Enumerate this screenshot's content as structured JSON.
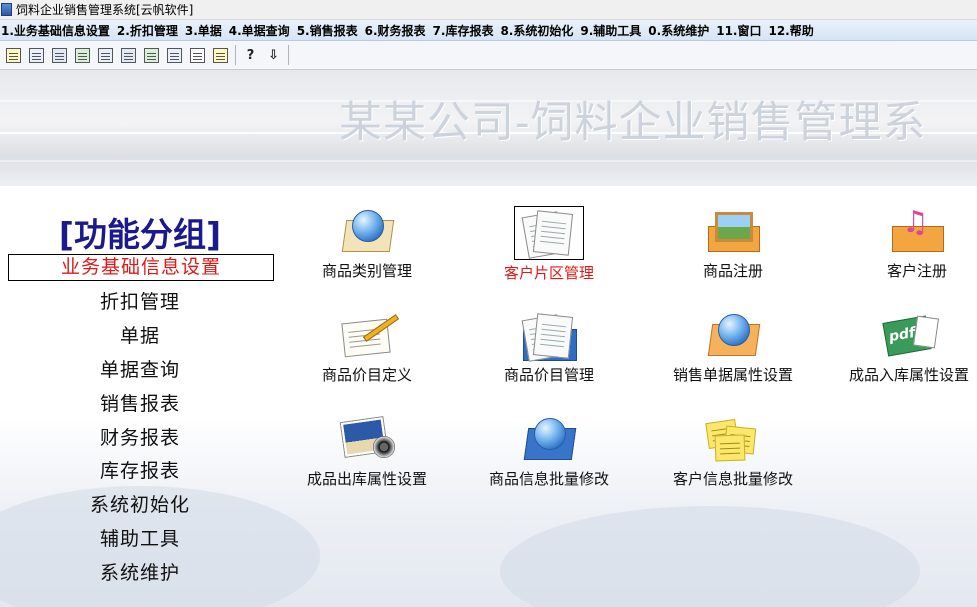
{
  "window": {
    "title": "饲料企业销售管理系统[云帆软件]"
  },
  "menu": [
    "1.业务基础信息设置",
    "2.折扣管理",
    "3.单据",
    "4.单据查询",
    "5.销售报表",
    "6.财务报表",
    "7.库存报表",
    "8.系统初始化",
    "9.辅助工具",
    "0.系统维护",
    "11.窗口",
    "12.帮助"
  ],
  "toolbar": {
    "icons": [
      "edit-icon",
      "form-icon",
      "grid-icon",
      "chart-icon",
      "users-icon",
      "warehouse-icon",
      "database-icon",
      "report-icon",
      "list-icon",
      "book-icon",
      "help-icon",
      "exit-icon"
    ],
    "help_glyph": "?",
    "exit_glyph": "⇩"
  },
  "banner": {
    "title": "某某公司-饲料企业销售管理系"
  },
  "sidebar": {
    "group_title": "[功能分组]",
    "items": [
      "业务基础信息设置",
      "折扣管理",
      "单据",
      "单据查询",
      "销售报表",
      "财务报表",
      "库存报表",
      "系统初始化",
      "辅助工具",
      "系统维护"
    ],
    "active_index": 0
  },
  "functions": [
    {
      "label": "商品类别管理",
      "icon": "globe-icon"
    },
    {
      "label": "客户片区管理",
      "icon": "documents-icon",
      "selected": true
    },
    {
      "label": "商品注册",
      "icon": "picture-frame-icon"
    },
    {
      "label": "客户注册",
      "icon": "music-note-icon"
    },
    {
      "label": "商品价目定义",
      "icon": "pencil-document-icon"
    },
    {
      "label": "商品价目管理",
      "icon": "blue-documents-icon"
    },
    {
      "label": "销售单据属性设置",
      "icon": "orange-globe-icon"
    },
    {
      "label": "成品入库属性设置",
      "icon": "pdf-document-icon"
    },
    {
      "label": "成品出库属性设置",
      "icon": "photo-camera-icon"
    },
    {
      "label": "商品信息批量修改",
      "icon": "blue-globe-icon"
    },
    {
      "label": "客户信息批量修改",
      "icon": "sticky-notes-icon"
    }
  ],
  "colors": {
    "active": "#e01818",
    "group_title": "#1a1a8c"
  }
}
